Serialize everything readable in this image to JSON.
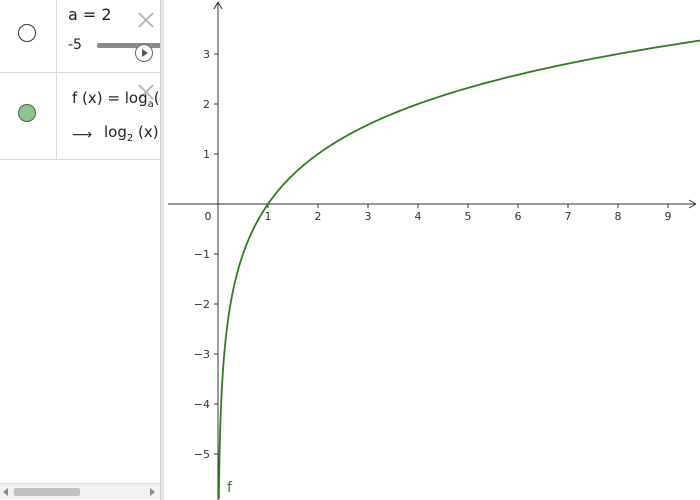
{
  "algebra": {
    "slider": {
      "label": "a = 2",
      "min_label": "-5",
      "value": 2
    },
    "function": {
      "definition_prefix": "f (x) = log",
      "definition_sub": "a",
      "definition_suffix": "(",
      "value_prefix": "log",
      "value_sub": "2",
      "value_suffix": "(x)",
      "arrow": "⟶"
    }
  },
  "colors": {
    "curve": "#2e7d20",
    "marble_f": "#8fc28f",
    "axis": "#333333"
  },
  "icons": {
    "row_a_close": "close-icon",
    "row_f_close": "close-icon",
    "play": "play-icon"
  },
  "chart_data": {
    "type": "line",
    "function": "log2(x)",
    "base": 2,
    "series": [
      {
        "name": "f",
        "expression": "log_2(x)"
      }
    ],
    "curve_label": "f",
    "xlim": [
      -1,
      9.6
    ],
    "ylim": [
      -5.8,
      4.1
    ],
    "x_ticks": [
      "0",
      "1",
      "2",
      "3",
      "4",
      "5",
      "6",
      "7",
      "8",
      "9"
    ],
    "y_ticks": [
      "3",
      "2",
      "1",
      "−1",
      "−2",
      "−3",
      "−4",
      "−5"
    ],
    "y_tick_values": [
      3,
      2,
      1,
      -1,
      -2,
      -3,
      -4,
      -5
    ],
    "grid": false
  }
}
